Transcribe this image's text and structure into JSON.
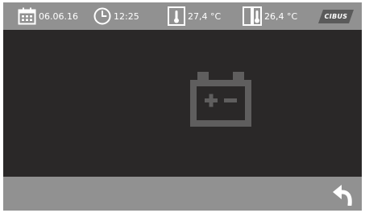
{
  "status_bar": {
    "date": "06.06.16",
    "time": "12:25",
    "temperature_1": "27,4 °C",
    "temperature_2": "26,4 °C",
    "logo_text": "CIBUS",
    "icons": {
      "date": "calendar-icon",
      "time": "clock-icon",
      "temperature_1": "thermometer-icon",
      "temperature_2": "thermometer-double-icon"
    }
  },
  "main": {
    "icon": "battery-icon"
  },
  "footer": {
    "back_icon": "back-arrow-icon"
  },
  "colors": {
    "bar_background": "#919191",
    "screen_background": "#2a2828",
    "battery_icon": "#5f5e5e",
    "text": "#ffffff",
    "logo_background": "#5a5a5a"
  }
}
